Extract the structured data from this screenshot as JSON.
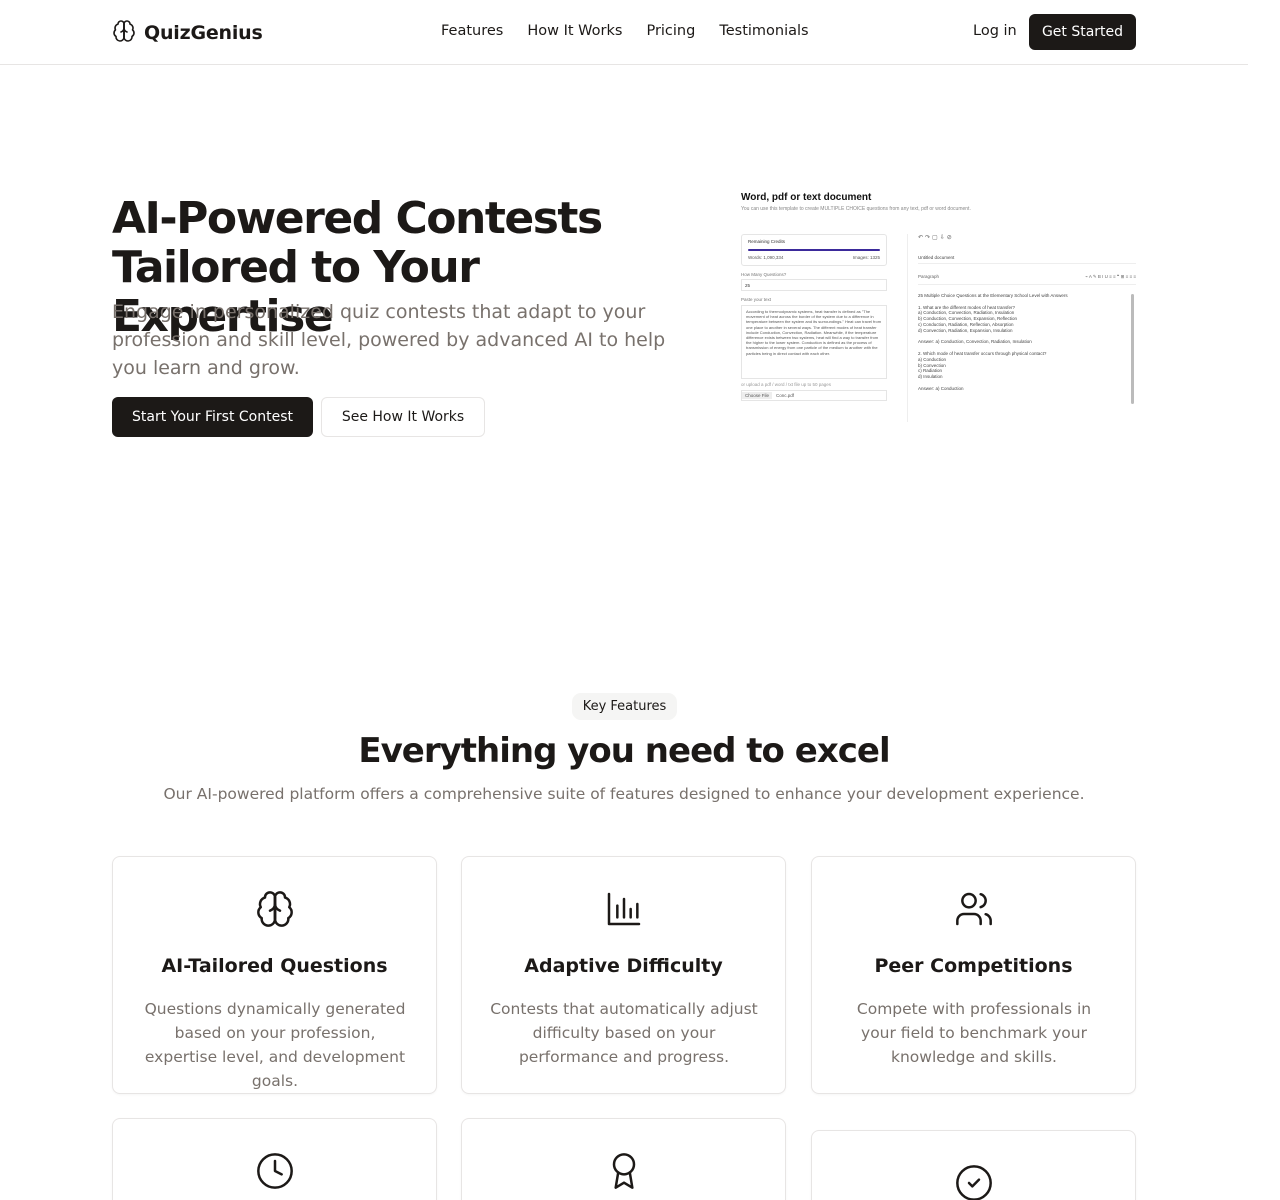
{
  "header": {
    "brand": "QuizGenius",
    "nav": [
      "Features",
      "How It Works",
      "Pricing",
      "Testimonials"
    ],
    "login": "Log in",
    "cta": "Get Started"
  },
  "hero": {
    "title_line1": "AI-Powered Contests",
    "title_line2": "Tailored to Your Expertise",
    "subtitle": "Engage in personalized quiz contests that adapt to your profession and skill level, powered by advanced AI to help you learn and grow.",
    "primary_button": "Start Your First Contest",
    "secondary_button": "See How It Works"
  },
  "mock": {
    "title": "Word, pdf or text document",
    "desc": "You can use this template to create MULTIPLE CHOICE questions from any text, pdf or word document.",
    "credits_label": "Remaining Credits",
    "words": "Words: 1,090,334",
    "images": "Images: 1325",
    "questions_label": "How Many Questions?",
    "questions_value": "25",
    "paste_label": "Paste your text",
    "paste_text": "According to thermodynamic systems, heat transfer is defined as \"The movement of heat across the border of the system due to a difference in temperature between the system and its surroundings.\" Heat can travel from one place to another in several ways. The different modes of heat transfer include Conduction, Convection, Radiation. Meanwhile, if the temperature difference exists between two systems, heat will find a way to transfer from the higher to the lower system. Conduction is defined as the process of transmission of energy from one particle of the medium to another with the particles being in direct contact with each other.",
    "upload_label": "or upload a pdf / word / txt file up to 50 pages",
    "choose_file": "Choose File",
    "file_name": "Conc.pdf",
    "doc_name": "Untitled document",
    "format_label": "Paragraph",
    "doc_content": "25 Multiple Choice Questions at the Elementary School Level with Answers\n\n1. What are the different modes of heat transfer?\na) Conduction, Convection, Radiation, Insulation\nb) Conduction, Convection, Expansion, Reflection\nc) Conduction, Radiation, Reflection, Absorption\nd) Convection, Radiation, Expansion, Insulation\n\nAnswer: a) Conduction, Convection, Radiation, Insulation\n\n2. Which mode of heat transfer occurs through physical contact?\na) Conduction\nb) Convection\nc) Radiation\nd) Insulation\n\nAnswer: a) Conduction"
  },
  "features": {
    "badge": "Key Features",
    "title": "Everything you need to excel",
    "subtitle": "Our AI-powered platform offers a comprehensive suite of features designed to enhance your development experience.",
    "cards": [
      {
        "icon": "brain-icon",
        "title": "AI-Tailored Questions",
        "desc": "Questions dynamically generated based on your profession, expertise level, and development goals."
      },
      {
        "icon": "bar-chart-icon",
        "title": "Adaptive Difficulty",
        "desc": "Contests that automatically adjust difficulty based on your performance and progress."
      },
      {
        "icon": "users-icon",
        "title": "Peer Competitions",
        "desc": "Compete with professionals in your field to benchmark your knowledge and skills."
      },
      {
        "icon": "clock-icon",
        "title": "",
        "desc": ""
      },
      {
        "icon": "award-icon",
        "title": "",
        "desc": ""
      },
      {
        "icon": "check-circle-icon",
        "title": "",
        "desc": ""
      }
    ]
  }
}
